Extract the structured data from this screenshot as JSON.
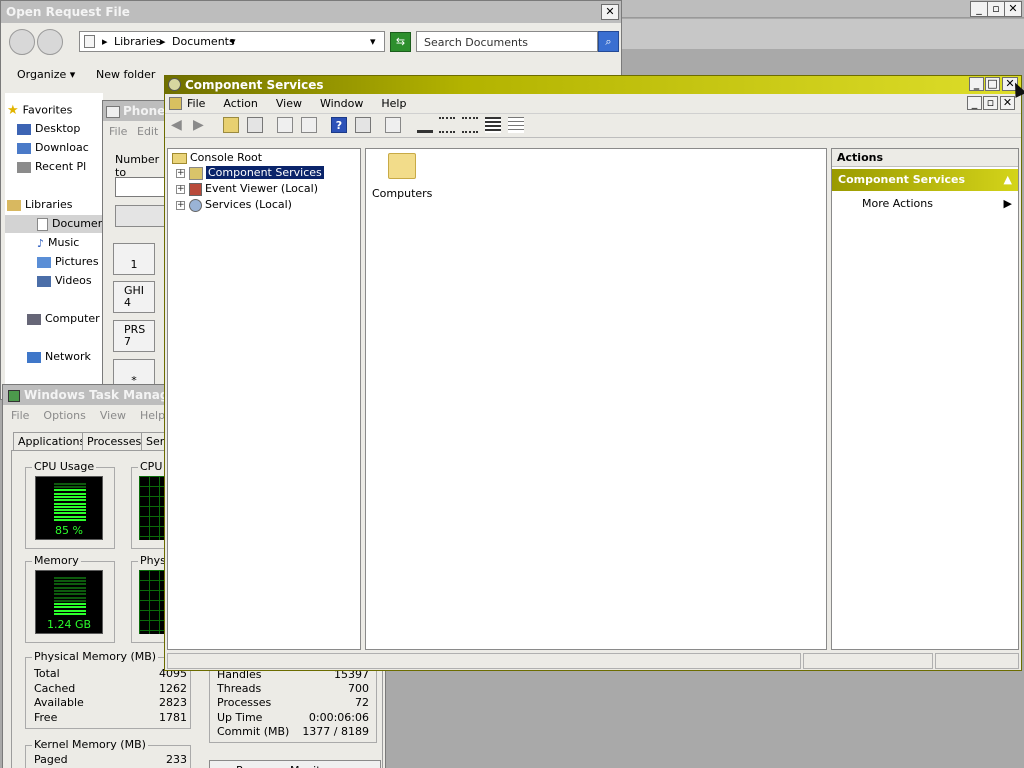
{
  "background_window": {
    "buttons": [
      "_",
      "▫",
      "✕"
    ]
  },
  "open_file": {
    "title": "Open Request File",
    "breadcrumb": [
      "Libraries",
      "Documents"
    ],
    "search_placeholder": "Search Documents",
    "toolbar": {
      "organize": "Organize",
      "new_folder": "New folder"
    },
    "nav": {
      "favorites": "Favorites",
      "desktop": "Desktop",
      "downloads": "Downloac",
      "recent": "Recent Pl",
      "libraries": "Libraries",
      "documents": "Documen",
      "music": "Music",
      "pictures": "Pictures",
      "videos": "Videos",
      "computer": "Computer",
      "network": "Network"
    }
  },
  "phone": {
    "title": "Phone",
    "menu": [
      "File",
      "Edit"
    ],
    "number_label": "Number to",
    "keys": [
      "1",
      "GHI\n4",
      "PRS\n7",
      "*"
    ]
  },
  "task_manager": {
    "title": "Windows Task Manager",
    "menu": [
      "File",
      "Options",
      "View",
      "Help"
    ],
    "tabs": [
      "Applications",
      "Processes",
      "Ser"
    ],
    "cpu_usage_label": "CPU Usage",
    "cpu_history_label": "CPU",
    "cpu_value": "85 %",
    "cpu_fraction": 0.85,
    "memory_label": "Memory",
    "phys_label": "Phys",
    "memory_value": "1.24 GB",
    "memory_fraction": 0.3,
    "physical_memory": {
      "title": "Physical Memory (MB)",
      "rows": [
        {
          "label": "Total",
          "value": "4095"
        },
        {
          "label": "Cached",
          "value": "1262"
        },
        {
          "label": "Available",
          "value": "2823"
        },
        {
          "label": "Free",
          "value": "1781"
        }
      ]
    },
    "system": {
      "rows": [
        {
          "label": "Handles",
          "value": "15397"
        },
        {
          "label": "Threads",
          "value": "700"
        },
        {
          "label": "Processes",
          "value": "72"
        },
        {
          "label": "Up Time",
          "value": "0:00:06:06"
        },
        {
          "label": "Commit (MB)",
          "value": "1377 / 8189"
        }
      ]
    },
    "kernel_memory": {
      "title": "Kernel Memory (MB)",
      "rows": [
        {
          "label": "Paged",
          "value": "233"
        }
      ]
    },
    "resource_button": "Resource Monitor..."
  },
  "component_services": {
    "title": "Component Services",
    "menu": [
      "File",
      "Action",
      "View",
      "Window",
      "Help"
    ],
    "tree": {
      "root": "Console Root",
      "items": [
        "Component Services",
        "Event Viewer (Local)",
        "Services (Local)"
      ]
    },
    "content": {
      "item": "Computers"
    },
    "actions": {
      "header": "Actions",
      "section": "Component Services",
      "more": "More Actions"
    },
    "colors": {
      "title_gradient_start": "#6f6f00",
      "title_gradient_end": "#dede2a",
      "selection": "#0a246a"
    }
  }
}
